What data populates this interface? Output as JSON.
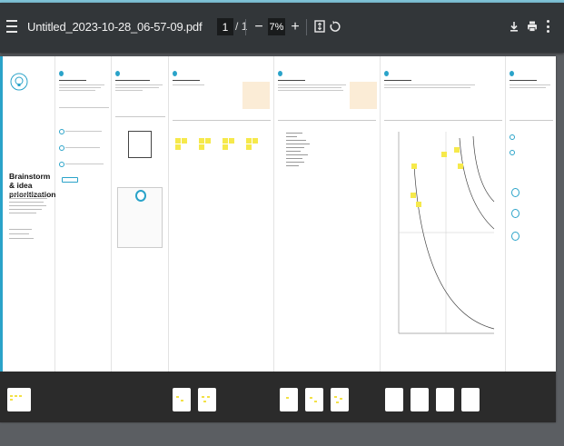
{
  "toolbar": {
    "title": "Untitled_2023-10-28_06-57-09.pdf",
    "page_current": "1",
    "page_sep": "/",
    "page_total": "1",
    "zoom_out": "−",
    "zoom_value": "7%",
    "zoom_in": "+",
    "icons": [
      "menu-icon",
      "fit-page-icon",
      "rotate-icon",
      "download-icon",
      "print-icon",
      "more-vert-icon"
    ]
  },
  "page": {
    "intro": {
      "title": "Brainstorm & idea prioritization"
    },
    "colors": {
      "accent": "#2aa3c9",
      "sticky": "#f6e94b",
      "toolbar": "#323639",
      "note": "#fbecd6"
    }
  }
}
